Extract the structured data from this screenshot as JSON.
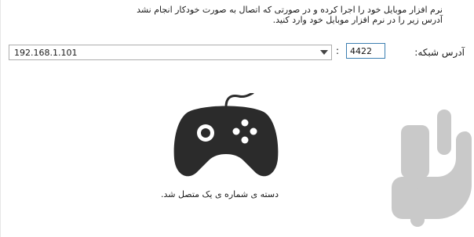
{
  "instructions": {
    "line1": "نرم افزار موبایل خود را اجرا کرده و در صورتی که اتصال به صورت خودکار انجام نشد",
    "line2": "آدرس زیر را در نرم افزار موبایل خود وارد کنید."
  },
  "connection": {
    "address_label": "آدرس شبکه:",
    "port_value": "4422",
    "separator": ":",
    "ip_selected": "192.168.1.101"
  },
  "status_text": "دسته ی شماره ی یک متصل شد.",
  "icons": {
    "gamepad": "gamepad-icon",
    "dropdown": "chevron-down-icon",
    "logo": "app-logo"
  },
  "colors": {
    "gamepad": "#2b2b2b",
    "logo": "#c9c9c9",
    "input_border_focus": "#3c7fb1"
  }
}
